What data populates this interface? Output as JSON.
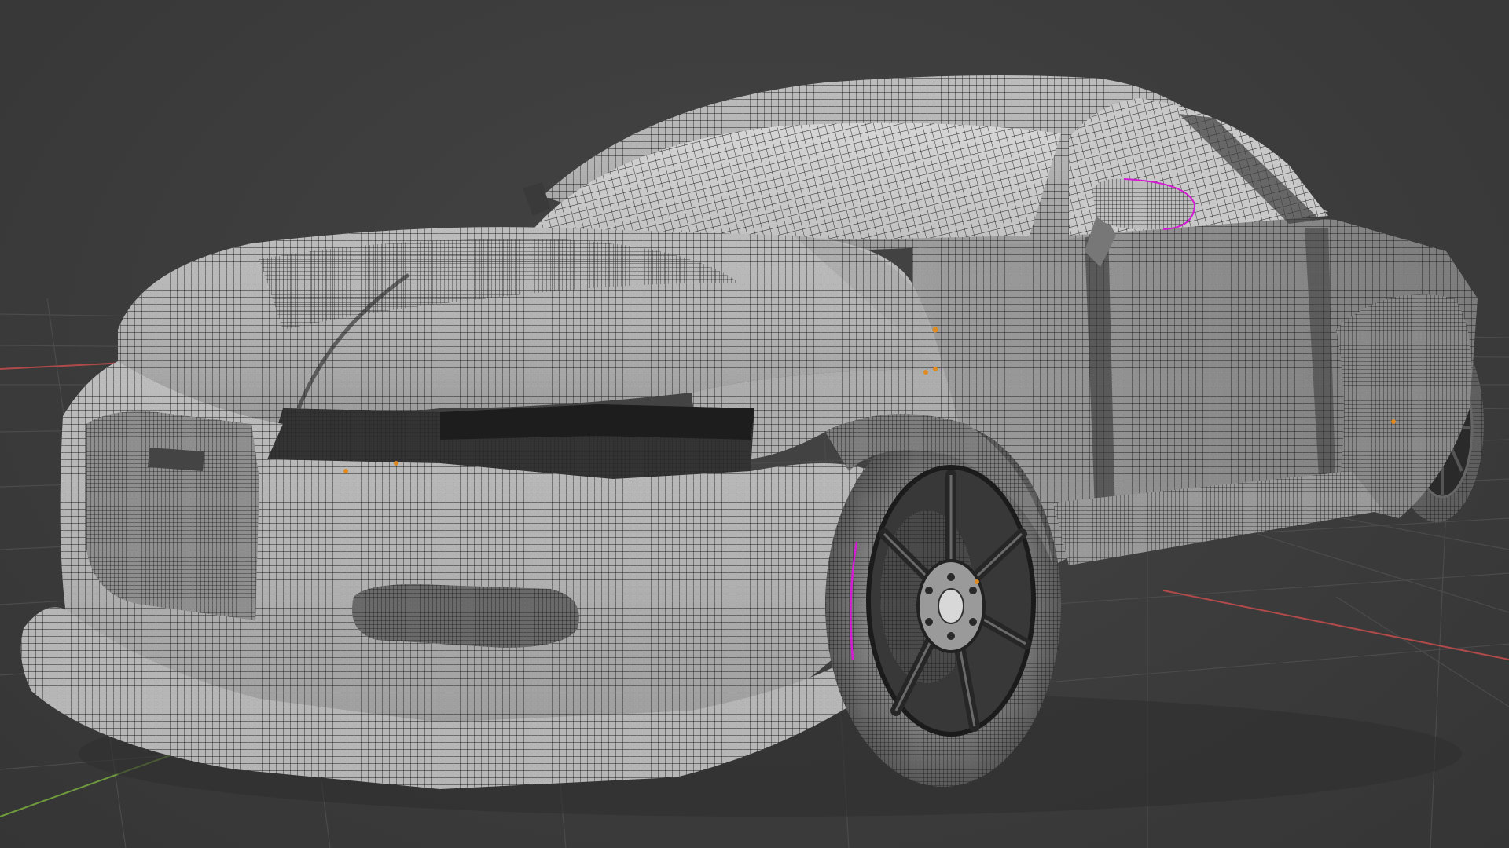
{
  "app": {
    "view": "3d-viewport",
    "shading": "wireframe-overlay",
    "object": "sports-car-mesh"
  },
  "colors": {
    "background": "#3d3d3d",
    "grid_line": "#4b4b4b",
    "x_axis": "#b04a4a",
    "y_axis": "#6f9a3c",
    "mesh_surface": "#a9a9a9",
    "mesh_light": "#cfcfcf",
    "mesh_wire": "#1c1c1c",
    "selected_edge": "#d41bd4",
    "origin_point": "#e08a20"
  }
}
